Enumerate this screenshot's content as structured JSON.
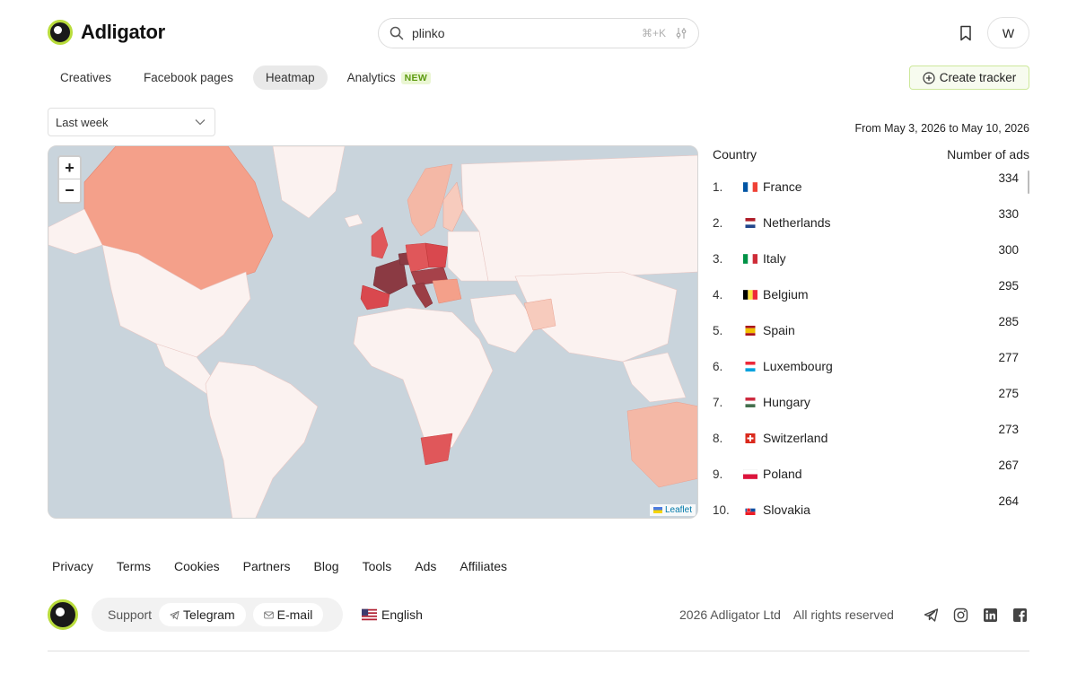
{
  "app": {
    "name": "Adligator"
  },
  "search": {
    "value": "plinko",
    "shortcut": "⌘+K"
  },
  "header": {
    "avatar_letter": "W"
  },
  "tabs": [
    {
      "label": "Creatives",
      "active": false
    },
    {
      "label": "Facebook pages",
      "active": false
    },
    {
      "label": "Heatmap",
      "active": true
    },
    {
      "label": "Analytics",
      "active": false,
      "badge": "NEW"
    }
  ],
  "actions": {
    "create_tracker": "Create tracker"
  },
  "filters": {
    "period": "Last week"
  },
  "date_range": "From May 3, 2026 to May 10, 2026",
  "map": {
    "zoom_in": "+",
    "zoom_out": "−",
    "attribution": "Leaflet"
  },
  "table": {
    "col_country": "Country",
    "col_ads": "Number of ads",
    "rows": [
      {
        "rank": "1.",
        "country": "France",
        "count": "334",
        "flag": "france-flag"
      },
      {
        "rank": "2.",
        "country": "Netherlands",
        "count": "330",
        "flag": "netherlands-flag"
      },
      {
        "rank": "3.",
        "country": "Italy",
        "count": "300",
        "flag": "italy-flag"
      },
      {
        "rank": "4.",
        "country": "Belgium",
        "count": "295",
        "flag": "belgium-flag"
      },
      {
        "rank": "5.",
        "country": "Spain",
        "count": "285",
        "flag": "spain-flag"
      },
      {
        "rank": "6.",
        "country": "Luxembourg",
        "count": "277",
        "flag": "luxembourg-flag"
      },
      {
        "rank": "7.",
        "country": "Hungary",
        "count": "275",
        "flag": "hungary-flag"
      },
      {
        "rank": "8.",
        "country": "Switzerland",
        "count": "273",
        "flag": "switzerland-flag"
      },
      {
        "rank": "9.",
        "country": "Poland",
        "count": "267",
        "flag": "poland-flag"
      },
      {
        "rank": "10.",
        "country": "Slovakia",
        "count": "264",
        "flag": "slovakia-flag"
      }
    ]
  },
  "footer": {
    "links": [
      "Privacy",
      "Terms",
      "Cookies",
      "Partners",
      "Blog",
      "Tools",
      "Ads",
      "Affiliates"
    ],
    "support_label": "Support",
    "telegram": "Telegram",
    "email": "E-mail",
    "language": "English",
    "copyright": "2026 Adligator Ltd",
    "rights": "All rights reserved"
  },
  "colors": {
    "brand_accent": "#b9dc3c",
    "heat_high": "#8b3a43",
    "heat_mid": "#e0575a",
    "heat_low": "#f4a08a",
    "land": "#fbf2f0",
    "water": "#c9d4dc"
  }
}
